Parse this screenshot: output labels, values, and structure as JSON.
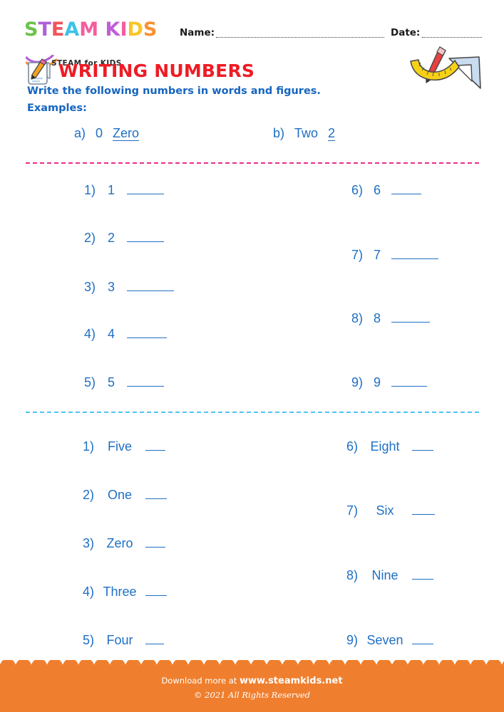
{
  "brand": {
    "wordmark_letters": [
      "S",
      "T",
      "E",
      "A",
      "M",
      " ",
      "K",
      "I",
      "D",
      "S"
    ],
    "wordmark_text": "STEAM KIDS",
    "tagline": "STEAM for KIDS",
    "colors": {
      "green": "#6cc24a",
      "purple": "#b05fd8",
      "red": "#f0545c",
      "cyan": "#3fc2e8",
      "pink": "#f45d9e",
      "yellow": "#f9c623",
      "orange": "#f99133"
    }
  },
  "header": {
    "name_label": "Name:",
    "name_value": "",
    "date_label": "Date:",
    "date_value": ""
  },
  "title": {
    "heading": "WRITING NUMBERS",
    "heading_color": "#ee1c25",
    "instructions": "Write the following numbers in words and figures.",
    "examples_label": "Examples:",
    "text_color": "#1565c0"
  },
  "examples": [
    {
      "marker": "a)",
      "given": "0",
      "answer": "Zero"
    },
    {
      "marker": "b)",
      "given": "Two",
      "answer": "2"
    }
  ],
  "dividers": {
    "top_color": "#ec2d87",
    "bottom_color": "#4fc3f7"
  },
  "section1": {
    "left": [
      {
        "num": "1)",
        "prompt": "1",
        "blank_width": 52
      },
      {
        "num": "2)",
        "prompt": "2",
        "blank_width": 52
      },
      {
        "num": "3)",
        "prompt": "3",
        "blank_width": 66
      },
      {
        "num": "4)",
        "prompt": "4",
        "blank_width": 56
      },
      {
        "num": "5)",
        "prompt": "5",
        "blank_width": 52
      }
    ],
    "right": [
      {
        "num": "6)",
        "prompt": "6",
        "blank_width": 42
      },
      {
        "num": "7)",
        "prompt": "7",
        "blank_width": 66
      },
      {
        "num": "8)",
        "prompt": "8",
        "blank_width": 54
      },
      {
        "num": "9)",
        "prompt": "9",
        "blank_width": 50
      }
    ]
  },
  "section2": {
    "left": [
      {
        "num": "1)",
        "prompt": "Five",
        "blank_width": 28
      },
      {
        "num": "2)",
        "prompt": "One",
        "blank_width": 30
      },
      {
        "num": "3)",
        "prompt": "Zero",
        "blank_width": 28
      },
      {
        "num": "4)",
        "prompt": "Three",
        "blank_width": 30
      },
      {
        "num": "5)",
        "prompt": "Four",
        "blank_width": 26
      }
    ],
    "right": [
      {
        "num": "6)",
        "prompt": "Eight",
        "blank_width": 30
      },
      {
        "num": "7)",
        "prompt": "Six",
        "blank_width": 32
      },
      {
        "num": "8)",
        "prompt": "Nine",
        "blank_width": 30
      },
      {
        "num": "9)",
        "prompt": "Seven",
        "blank_width": 30
      }
    ]
  },
  "footer": {
    "download_text": "Download more at",
    "site": "www.steamkids.net",
    "copyright": "© 2021 All Rights Reserved",
    "background": "#ef7f2e"
  },
  "icons": {
    "notepad": "notepad-pencil-icon",
    "tools": "ruler-pencil-triangle-icon"
  }
}
